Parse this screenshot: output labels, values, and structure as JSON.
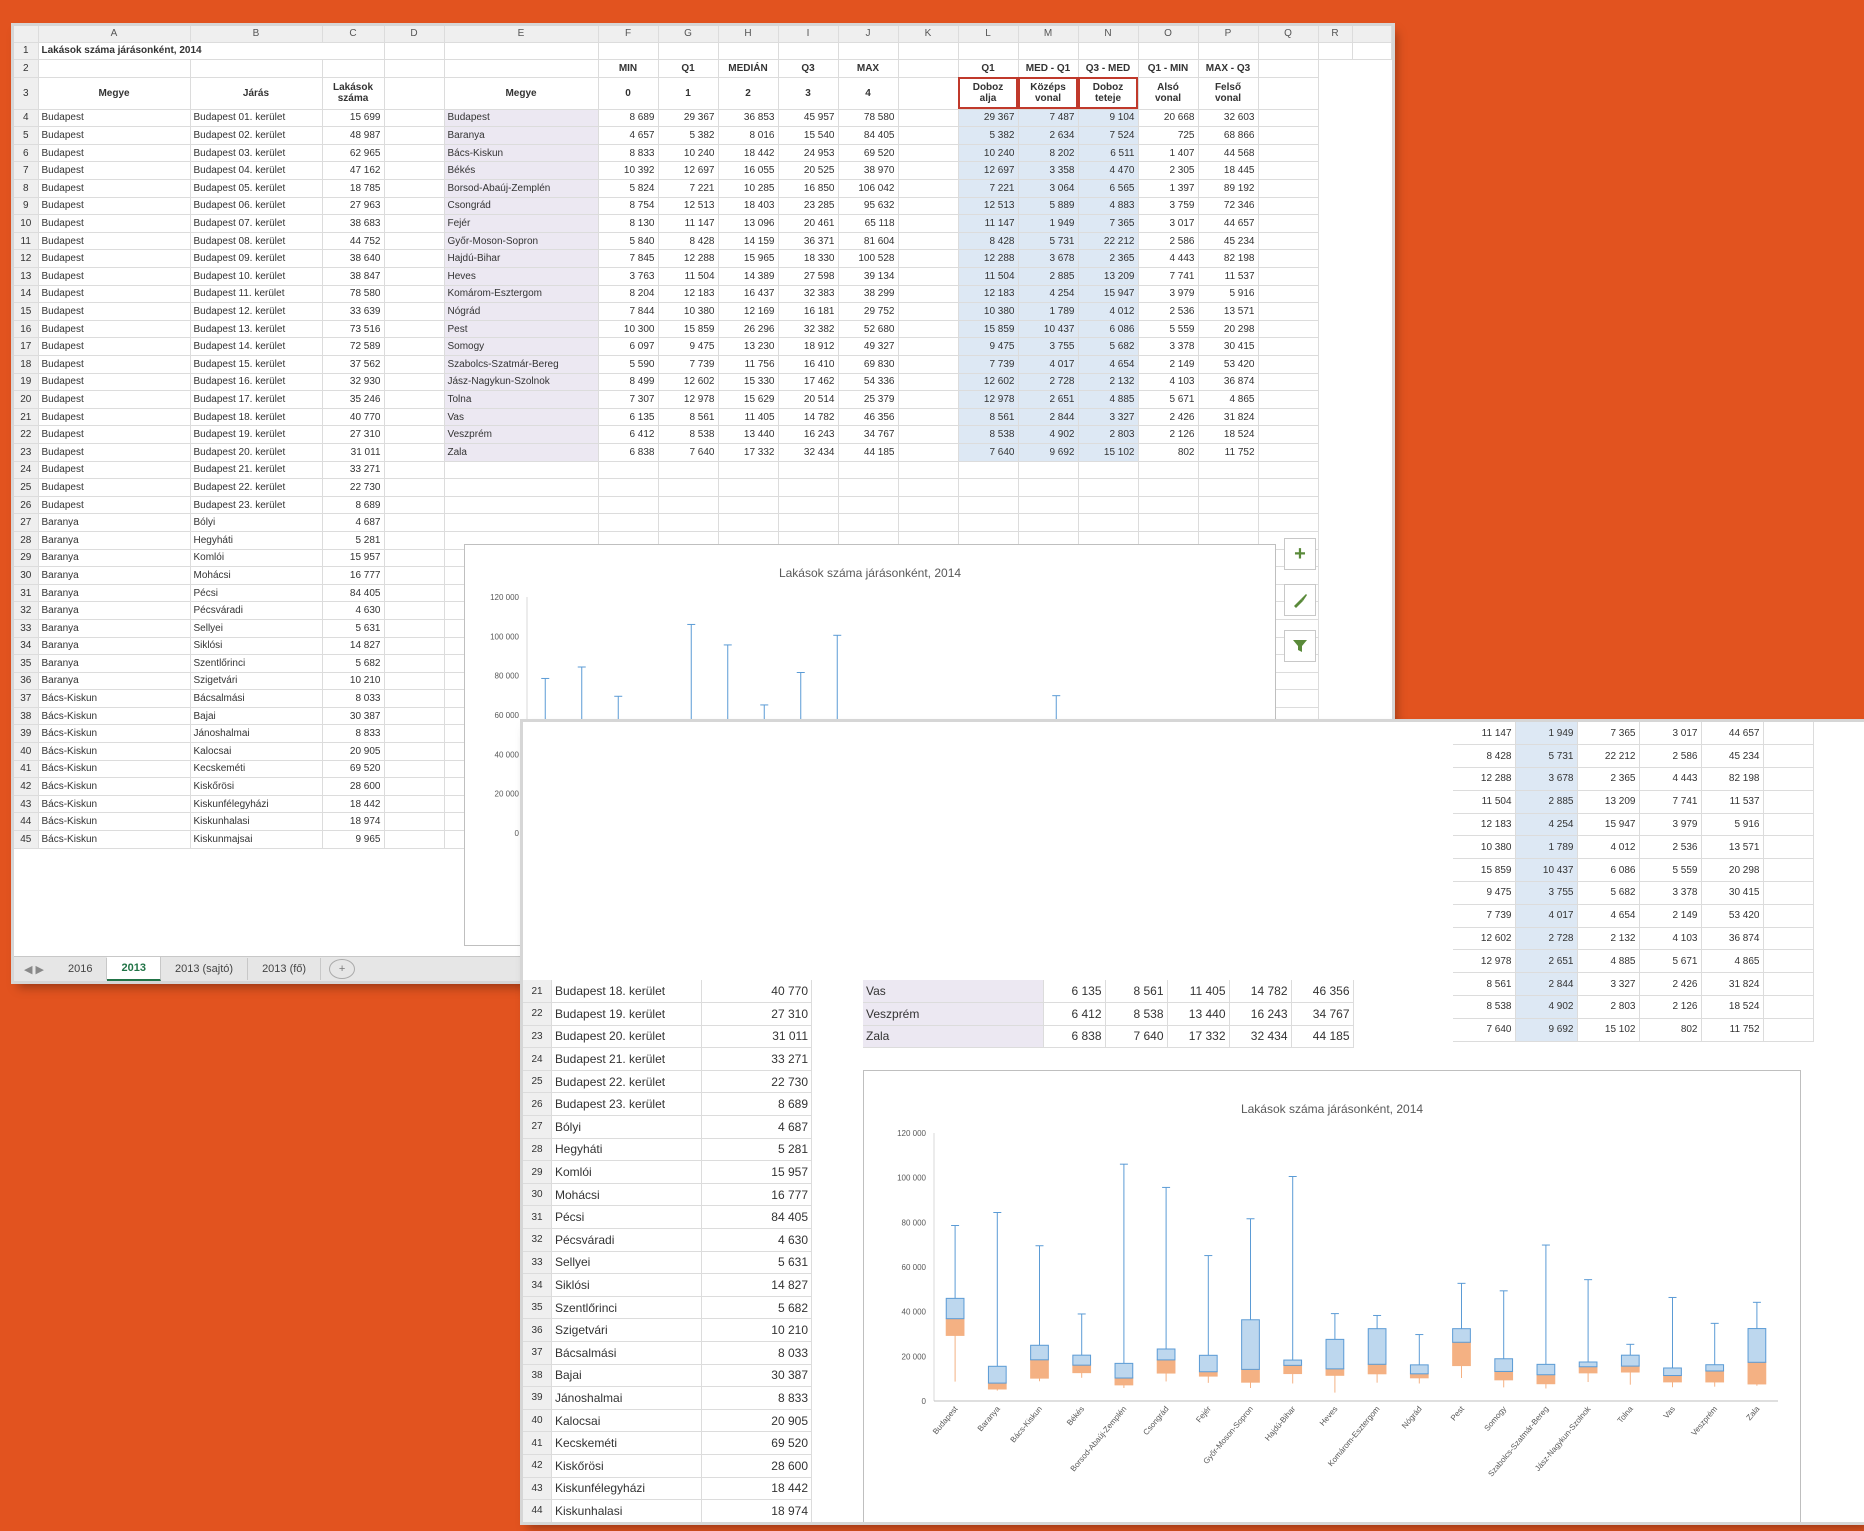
{
  "sheet_title": "Lakások száma járásonként, 2014",
  "columns": [
    "A",
    "B",
    "C",
    "D",
    "E",
    "F",
    "G",
    "H",
    "I",
    "J",
    "K",
    "L",
    "M",
    "N",
    "O",
    "P",
    "Q",
    "R"
  ],
  "headers": {
    "megye": "Megye",
    "jaras": "Járás",
    "lakasok": [
      "Lakások",
      "száma"
    ],
    "stat_row2": [
      "MIN",
      "Q1",
      "MEDIÁN",
      "Q3",
      "MAX"
    ],
    "stat_row3": [
      "0",
      "1",
      "2",
      "3",
      "4"
    ],
    "calc_row2": [
      "Q1",
      "MED - Q1",
      "Q3 - MED",
      "Q1 - MIN",
      "MAX - Q3"
    ],
    "calc_row3a": [
      "Doboz",
      "Középs",
      "Doboz",
      "Alsó",
      "Felső"
    ],
    "calc_row3b": [
      "alja",
      "vonal",
      "teteje",
      "vonal",
      "vonal"
    ]
  },
  "rows_main": [
    [
      "Budapest",
      "Budapest 01. kerület",
      "15 699"
    ],
    [
      "Budapest",
      "Budapest 02. kerület",
      "48 987"
    ],
    [
      "Budapest",
      "Budapest 03. kerület",
      "62 965"
    ],
    [
      "Budapest",
      "Budapest 04. kerület",
      "47 162"
    ],
    [
      "Budapest",
      "Budapest 05. kerület",
      "18 785"
    ],
    [
      "Budapest",
      "Budapest 06. kerület",
      "27 963"
    ],
    [
      "Budapest",
      "Budapest 07. kerület",
      "38 683"
    ],
    [
      "Budapest",
      "Budapest 08. kerület",
      "44 752"
    ],
    [
      "Budapest",
      "Budapest 09. kerület",
      "38 640"
    ],
    [
      "Budapest",
      "Budapest 10. kerület",
      "38 847"
    ],
    [
      "Budapest",
      "Budapest 11. kerület",
      "78 580"
    ],
    [
      "Budapest",
      "Budapest 12. kerület",
      "33 639"
    ],
    [
      "Budapest",
      "Budapest 13. kerület",
      "73 516"
    ],
    [
      "Budapest",
      "Budapest 14. kerület",
      "72 589"
    ],
    [
      "Budapest",
      "Budapest 15. kerület",
      "37 562"
    ],
    [
      "Budapest",
      "Budapest 16. kerület",
      "32 930"
    ],
    [
      "Budapest",
      "Budapest 17. kerület",
      "35 246"
    ],
    [
      "Budapest",
      "Budapest 18. kerület",
      "40 770"
    ],
    [
      "Budapest",
      "Budapest 19. kerület",
      "27 310"
    ],
    [
      "Budapest",
      "Budapest 20. kerület",
      "31 011"
    ],
    [
      "Budapest",
      "Budapest 21. kerület",
      "33 271"
    ],
    [
      "Budapest",
      "Budapest 22. kerület",
      "22 730"
    ],
    [
      "Budapest",
      "Budapest 23. kerület",
      "8 689"
    ],
    [
      "Baranya",
      "Bólyi",
      "4 687"
    ],
    [
      "Baranya",
      "Hegyháti",
      "5 281"
    ],
    [
      "Baranya",
      "Komlói",
      "15 957"
    ],
    [
      "Baranya",
      "Mohácsi",
      "16 777"
    ],
    [
      "Baranya",
      "Pécsi",
      "84 405"
    ],
    [
      "Baranya",
      "Pécsváradi",
      "4 630"
    ],
    [
      "Baranya",
      "Sellyei",
      "5 631"
    ],
    [
      "Baranya",
      "Siklósi",
      "14 827"
    ],
    [
      "Baranya",
      "Szentlőrinci",
      "5 682"
    ],
    [
      "Baranya",
      "Szigetvári",
      "10 210"
    ],
    [
      "Bács-Kiskun",
      "Bácsalmási",
      "8 033"
    ],
    [
      "Bács-Kiskun",
      "Bajai",
      "30 387"
    ],
    [
      "Bács-Kiskun",
      "Jánoshalmai",
      "8 833"
    ],
    [
      "Bács-Kiskun",
      "Kalocsai",
      "20 905"
    ],
    [
      "Bács-Kiskun",
      "Kecskeméti",
      "69 520"
    ],
    [
      "Bács-Kiskun",
      "Kiskőrösi",
      "28 600"
    ],
    [
      "Bács-Kiskun",
      "Kiskunfélegyházi",
      "18 442"
    ],
    [
      "Bács-Kiskun",
      "Kiskunhalasi",
      "18 974"
    ],
    [
      "Bács-Kiskun",
      "Kiskunmajsai",
      "9 965"
    ]
  ],
  "stats": [
    [
      "Budapest",
      "8 689",
      "29 367",
      "36 853",
      "45 957",
      "78 580",
      "29 367",
      "7 487",
      "9 104",
      "20 668",
      "32 603"
    ],
    [
      "Baranya",
      "4 657",
      "5 382",
      "8 016",
      "15 540",
      "84 405",
      "5 382",
      "2 634",
      "7 524",
      "725",
      "68 866"
    ],
    [
      "Bács-Kiskun",
      "8 833",
      "10 240",
      "18 442",
      "24 953",
      "69 520",
      "10 240",
      "8 202",
      "6 511",
      "1 407",
      "44 568"
    ],
    [
      "Békés",
      "10 392",
      "12 697",
      "16 055",
      "20 525",
      "38 970",
      "12 697",
      "3 358",
      "4 470",
      "2 305",
      "18 445"
    ],
    [
      "Borsod-Abaúj-Zemplén",
      "5 824",
      "7 221",
      "10 285",
      "16 850",
      "106 042",
      "7 221",
      "3 064",
      "6 565",
      "1 397",
      "89 192"
    ],
    [
      "Csongrád",
      "8 754",
      "12 513",
      "18 403",
      "23 285",
      "95 632",
      "12 513",
      "5 889",
      "4 883",
      "3 759",
      "72 346"
    ],
    [
      "Fejér",
      "8 130",
      "11 147",
      "13 096",
      "20 461",
      "65 118",
      "11 147",
      "1 949",
      "7 365",
      "3 017",
      "44 657"
    ],
    [
      "Győr-Moson-Sopron",
      "5 840",
      "8 428",
      "14 159",
      "36 371",
      "81 604",
      "8 428",
      "5 731",
      "22 212",
      "2 586",
      "45 234"
    ],
    [
      "Hajdú-Bihar",
      "7 845",
      "12 288",
      "15 965",
      "18 330",
      "100 528",
      "12 288",
      "3 678",
      "2 365",
      "4 443",
      "82 198"
    ],
    [
      "Heves",
      "3 763",
      "11 504",
      "14 389",
      "27 598",
      "39 134",
      "11 504",
      "2 885",
      "13 209",
      "7 741",
      "11 537"
    ],
    [
      "Komárom-Esztergom",
      "8 204",
      "12 183",
      "16 437",
      "32 383",
      "38 299",
      "12 183",
      "4 254",
      "15 947",
      "3 979",
      "5 916"
    ],
    [
      "Nógrád",
      "7 844",
      "10 380",
      "12 169",
      "16 181",
      "29 752",
      "10 380",
      "1 789",
      "4 012",
      "2 536",
      "13 571"
    ],
    [
      "Pest",
      "10 300",
      "15 859",
      "26 296",
      "32 382",
      "52 680",
      "15 859",
      "10 437",
      "6 086",
      "5 559",
      "20 298"
    ],
    [
      "Somogy",
      "6 097",
      "9 475",
      "13 230",
      "18 912",
      "49 327",
      "9 475",
      "3 755",
      "5 682",
      "3 378",
      "30 415"
    ],
    [
      "Szabolcs-Szatmár-Bereg",
      "5 590",
      "7 739",
      "11 756",
      "16 410",
      "69 830",
      "7 739",
      "4 017",
      "4 654",
      "2 149",
      "53 420"
    ],
    [
      "Jász-Nagykun-Szolnok",
      "8 499",
      "12 602",
      "15 330",
      "17 462",
      "54 336",
      "12 602",
      "2 728",
      "2 132",
      "4 103",
      "36 874"
    ],
    [
      "Tolna",
      "7 307",
      "12 978",
      "15 629",
      "20 514",
      "25 379",
      "12 978",
      "2 651",
      "4 885",
      "5 671",
      "4 865"
    ],
    [
      "Vas",
      "6 135",
      "8 561",
      "11 405",
      "14 782",
      "46 356",
      "8 561",
      "2 844",
      "3 327",
      "2 426",
      "31 824"
    ],
    [
      "Veszprém",
      "6 412",
      "8 538",
      "13 440",
      "16 243",
      "34 767",
      "8 538",
      "4 902",
      "2 803",
      "2 126",
      "18 524"
    ],
    [
      "Zala",
      "6 838",
      "7 640",
      "17 332",
      "32 434",
      "44 185",
      "7 640",
      "9 692",
      "15 102",
      "802",
      "11 752"
    ]
  ],
  "chart_data": [
    {
      "type": "bar",
      "title": "Lakások száma járásonként, 2014",
      "categories": [
        "Budapest",
        "Baranya",
        "Bács-Kiskun",
        "Békés",
        "Borsod-Abaúj-Zemplén",
        "Csongrád",
        "Fejér",
        "Győr-Moson-Sopron",
        "Hajdú-Bihar",
        "Heves",
        "Komárom-Esztergom",
        "Nógrád",
        "Pest",
        "Somogy",
        "Szabolcs-Szatmár-Bereg",
        "Jász-Nagykun-Szolnok",
        "Tolna",
        "Vas",
        "Veszprém",
        "Zala"
      ],
      "ylim": [
        0,
        120000
      ],
      "yticks": [
        "0",
        "20 000",
        "40 000",
        "60 000",
        "80 000",
        "100 000",
        "120 000"
      ],
      "min": [
        8689,
        4657,
        8833,
        10392,
        5824,
        8754,
        8130,
        5840,
        7845,
        3763,
        8204,
        7844,
        10300,
        6097,
        5590,
        8499,
        7307,
        6135,
        6412,
        6838
      ],
      "q1": [
        29367,
        5382,
        10240,
        12697,
        7221,
        12513,
        11147,
        8428,
        12288,
        11504,
        12183,
        10380,
        15859,
        9475,
        7739,
        12602,
        12978,
        8561,
        8538,
        7640
      ],
      "median": [
        36853,
        8016,
        18442,
        16055,
        10285,
        18403,
        13096,
        14159,
        15965,
        14389,
        16437,
        12169,
        26296,
        13230,
        11756,
        15330,
        15629,
        11405,
        13440,
        17332
      ],
      "q3": [
        45957,
        15540,
        24953,
        20525,
        16850,
        23285,
        20461,
        36371,
        18330,
        27598,
        32383,
        16181,
        32382,
        18912,
        16410,
        17462,
        20514,
        14782,
        16243,
        32434
      ],
      "max": [
        78580,
        84405,
        69520,
        38970,
        106042,
        95632,
        65118,
        81604,
        100528,
        39134,
        38299,
        29752,
        52680,
        49327,
        69830,
        54336,
        25379,
        46356,
        34767,
        44185
      ],
      "colors": {
        "box": "#bdd7ee",
        "box_border": "#5b9bd5",
        "lower_box": "#f4b183"
      }
    }
  ],
  "sidebar_buttons": [
    "+",
    "brush",
    "filter"
  ],
  "tabs": [
    "2016",
    "2013",
    "2013 (sajtó)",
    "2013 (fő)"
  ],
  "active_tab": "2013",
  "win2_rows": [
    [
      "21",
      "Budapest 18. kerület",
      "40 770"
    ],
    [
      "22",
      "Budapest 19. kerület",
      "27 310"
    ],
    [
      "23",
      "Budapest 20. kerület",
      "31 011"
    ],
    [
      "24",
      "Budapest 21. kerület",
      "33 271"
    ],
    [
      "25",
      "Budapest 22. kerület",
      "22 730"
    ],
    [
      "26",
      "Budapest 23. kerület",
      "8 689"
    ],
    [
      "27",
      "Bólyi",
      "4 687"
    ],
    [
      "28",
      "Hegyháti",
      "5 281"
    ],
    [
      "29",
      "Komlói",
      "15 957"
    ],
    [
      "30",
      "Mohácsi",
      "16 777"
    ],
    [
      "31",
      "Pécsi",
      "84 405"
    ],
    [
      "32",
      "Pécsváradi",
      "4 630"
    ],
    [
      "33",
      "Sellyei",
      "5 631"
    ],
    [
      "34",
      "Siklósi",
      "14 827"
    ],
    [
      "35",
      "Szentlőrinci",
      "5 682"
    ],
    [
      "36",
      "Szigetvári",
      "10 210"
    ],
    [
      "37",
      "Bácsalmási",
      "8 033"
    ],
    [
      "38",
      "Bajai",
      "30 387"
    ],
    [
      "39",
      "Jánoshalmai",
      "8 833"
    ],
    [
      "40",
      "Kalocsai",
      "20 905"
    ],
    [
      "41",
      "Kecskeméti",
      "69 520"
    ],
    [
      "42",
      "Kiskőrösi",
      "28 600"
    ],
    [
      "43",
      "Kiskunfélegyházi",
      "18 442"
    ],
    [
      "44",
      "Kiskunhalasi",
      "18 974"
    ]
  ],
  "win2_top_rows": [
    [
      "11 147",
      "1 949",
      "7 365",
      "3 017",
      "44 657"
    ],
    [
      "8 428",
      "5 731",
      "22 212",
      "2 586",
      "45 234"
    ],
    [
      "12 288",
      "3 678",
      "2 365",
      "4 443",
      "82 198"
    ],
    [
      "11 504",
      "2 885",
      "13 209",
      "7 741",
      "11 537"
    ],
    [
      "12 183",
      "4 254",
      "15 947",
      "3 979",
      "5 916"
    ],
    [
      "10 380",
      "1 789",
      "4 012",
      "2 536",
      "13 571"
    ],
    [
      "15 859",
      "10 437",
      "6 086",
      "5 559",
      "20 298"
    ],
    [
      "9 475",
      "3 755",
      "5 682",
      "3 378",
      "30 415"
    ],
    [
      "7 739",
      "4 017",
      "4 654",
      "2 149",
      "53 420"
    ],
    [
      "12 602",
      "2 728",
      "2 132",
      "4 103",
      "36 874"
    ],
    [
      "12 978",
      "2 651",
      "4 885",
      "5 671",
      "4 865"
    ],
    [
      "8 561",
      "2 844",
      "3 327",
      "2 426",
      "31 824"
    ],
    [
      "8 538",
      "4 902",
      "2 803",
      "2 126",
      "18 524"
    ],
    [
      "7 640",
      "9 692",
      "15 102",
      "802",
      "11 752"
    ]
  ],
  "win2_mid_rows": [
    [
      "Vas",
      "6 135",
      "8 561",
      "11 405",
      "14 782",
      "46 356"
    ],
    [
      "Veszprém",
      "6 412",
      "8 538",
      "13 440",
      "16 243",
      "34 767"
    ],
    [
      "Zala",
      "6 838",
      "7 640",
      "17 332",
      "32 434",
      "44 185"
    ]
  ]
}
